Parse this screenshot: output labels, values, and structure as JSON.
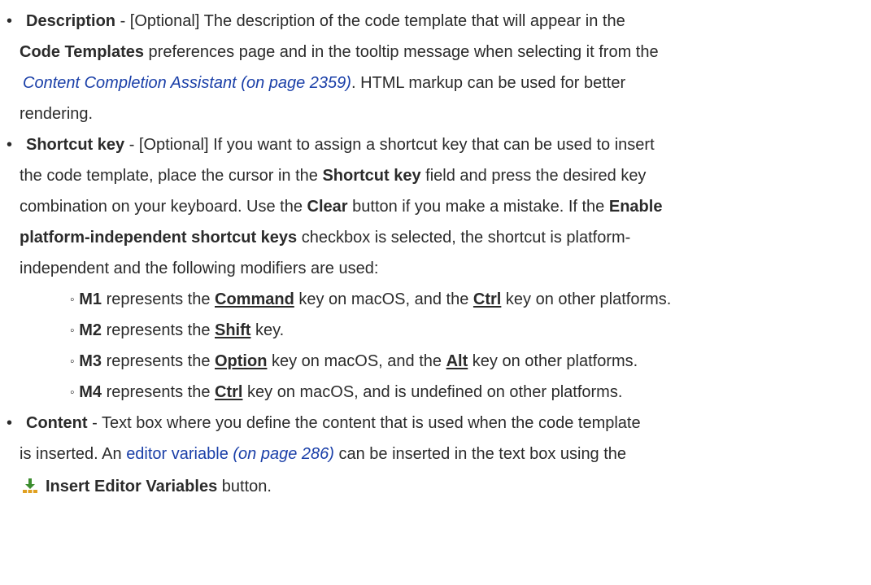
{
  "bullet_char": "•",
  "sub_bullet_char": "◦",
  "description": {
    "term": "Description",
    "sep": " - [Optional] The description of the code template that will appear in the",
    "line2_bold": "Code Templates",
    "line2_rest": " preferences page and in the tooltip message when selecting it from the",
    "link_text": "Content Completion Assistant (on page 2359)",
    "line3_rest": ". HTML markup can be used for better",
    "line4": "rendering."
  },
  "shortcut": {
    "term": "Shortcut key",
    "line1_rest": " - [Optional] If you want to assign a shortcut key that can be used to insert",
    "line2_a": "the code template, place the cursor in the ",
    "line2_bold": "Shortcut key",
    "line2_b": " field and press the desired key",
    "line3_a": "combination on your keyboard. Use the ",
    "line3_bold1": "Clear",
    "line3_b": " button if you make a mistake. If the ",
    "line3_bold2": "Enable",
    "line4_bold": "platform-independent shortcut keys",
    "line4_rest": " checkbox is selected, the shortcut is platform-",
    "line5": "independent and the following modifiers are used:",
    "modifiers": [
      {
        "mod": "M1",
        "a": " represents the ",
        "k1": "Command",
        "b": " key on macOS, and the ",
        "k2": "Ctrl",
        "c": " key on other platforms."
      },
      {
        "mod": "M2",
        "a": " represents the ",
        "k1": "Shift",
        "b": " key."
      },
      {
        "mod": "M3",
        "a": " represents the ",
        "k1": "Option",
        "b": " key on macOS, and the ",
        "k2": "Alt",
        "c": " key on other platforms."
      },
      {
        "mod": "M4",
        "a": " represents the ",
        "k1": "Ctrl",
        "b": " key on macOS, and is undefined on other platforms."
      }
    ]
  },
  "content": {
    "term": "Content",
    "line1_rest": " - Text box where you define the content that is used when the code template",
    "line2_a": "is inserted. An ",
    "link_text": "editor variable",
    "link_page": "(on page 286)",
    "line2_b": " can be inserted in the text box using the",
    "button_label": "Insert Editor Variables",
    "line3_rest": " button."
  },
  "colors": {
    "text": "#2b2b2b",
    "link": "#1a3fa8",
    "icon_arrow": "#3c8d2f",
    "icon_base": "#e0a020"
  },
  "icon": "insert-editor-variables-icon"
}
